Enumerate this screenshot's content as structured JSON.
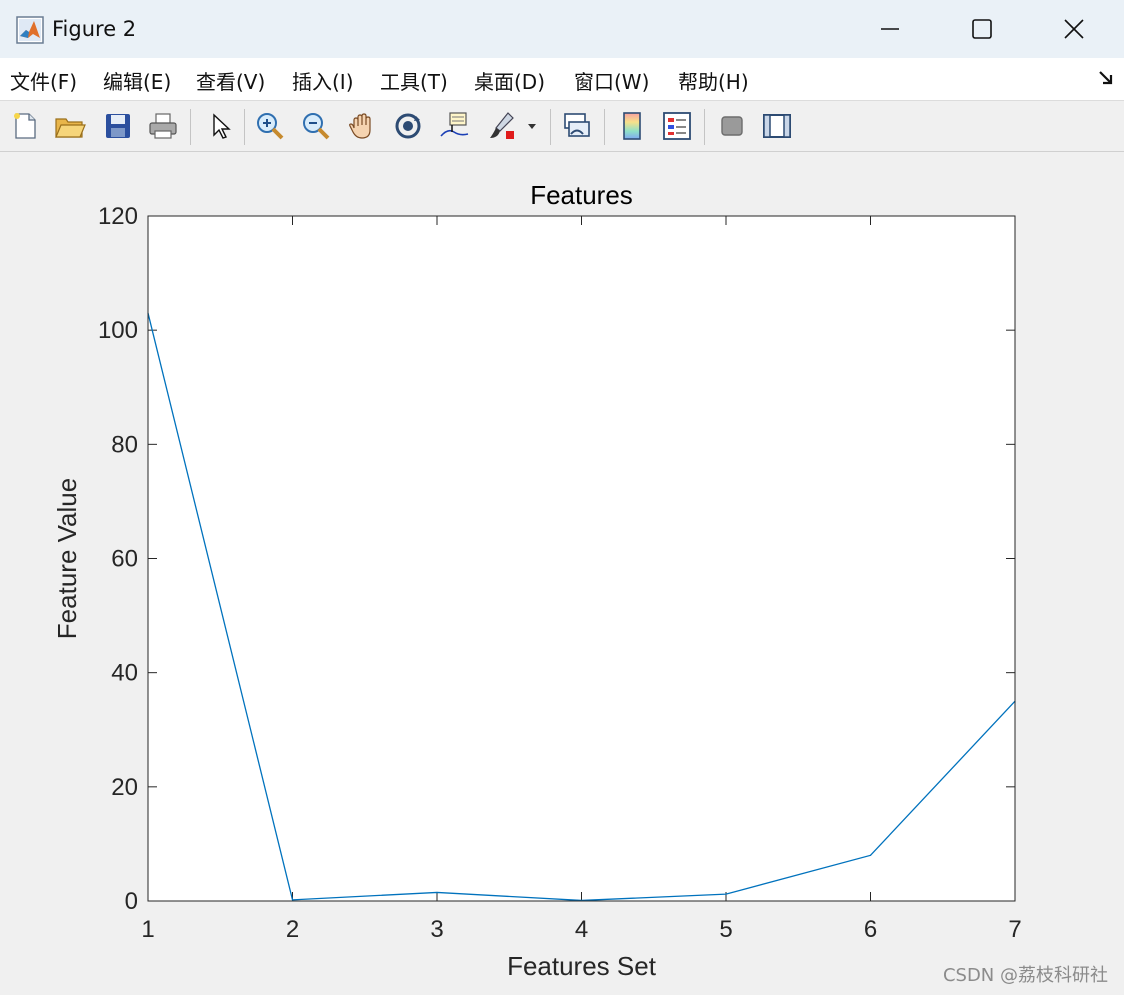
{
  "window": {
    "title": "Figure 2",
    "icon": "matlab-icon",
    "controls": [
      "minimize-icon",
      "maximize-icon",
      "close-icon"
    ]
  },
  "menu": {
    "items": [
      {
        "label": "文件(F)"
      },
      {
        "label": "编辑(E)"
      },
      {
        "label": "查看(V)"
      },
      {
        "label": "插入(I)"
      },
      {
        "label": "工具(T)"
      },
      {
        "label": "桌面(D)"
      },
      {
        "label": "窗口(W)"
      },
      {
        "label": "帮助(H)"
      }
    ],
    "dock_icon": "dock-arrow-icon"
  },
  "toolbar": {
    "icons": [
      "new-figure-icon",
      "open-file-icon",
      "save-icon",
      "print-icon",
      "pointer-icon",
      "zoom-in-icon",
      "zoom-out-icon",
      "pan-icon",
      "rotate-3d-icon",
      "data-cursor-icon",
      "brush-icon",
      "dropdown-arrow-icon",
      "link-plot-icon",
      "colorbar-icon",
      "legend-icon",
      "hide-plot-tools-icon",
      "show-plot-tools-icon"
    ]
  },
  "chart_data": {
    "type": "line",
    "title": "Features",
    "xlabel": "Features Set",
    "ylabel": "Feature Value",
    "x": [
      1,
      2,
      3,
      4,
      5,
      6,
      7
    ],
    "series": [
      {
        "values": [
          103,
          0.2,
          1.5,
          0.1,
          1.2,
          8,
          35
        ],
        "color": "#0072bd"
      }
    ],
    "xlim": [
      1,
      7
    ],
    "ylim": [
      0,
      120
    ],
    "xticks": [
      "1",
      "2",
      "3",
      "4",
      "5",
      "6",
      "7"
    ],
    "yticks": [
      "0",
      "20",
      "40",
      "60",
      "80",
      "100",
      "120"
    ],
    "grid": false
  },
  "watermark": "CSDN @荔枝科研社"
}
